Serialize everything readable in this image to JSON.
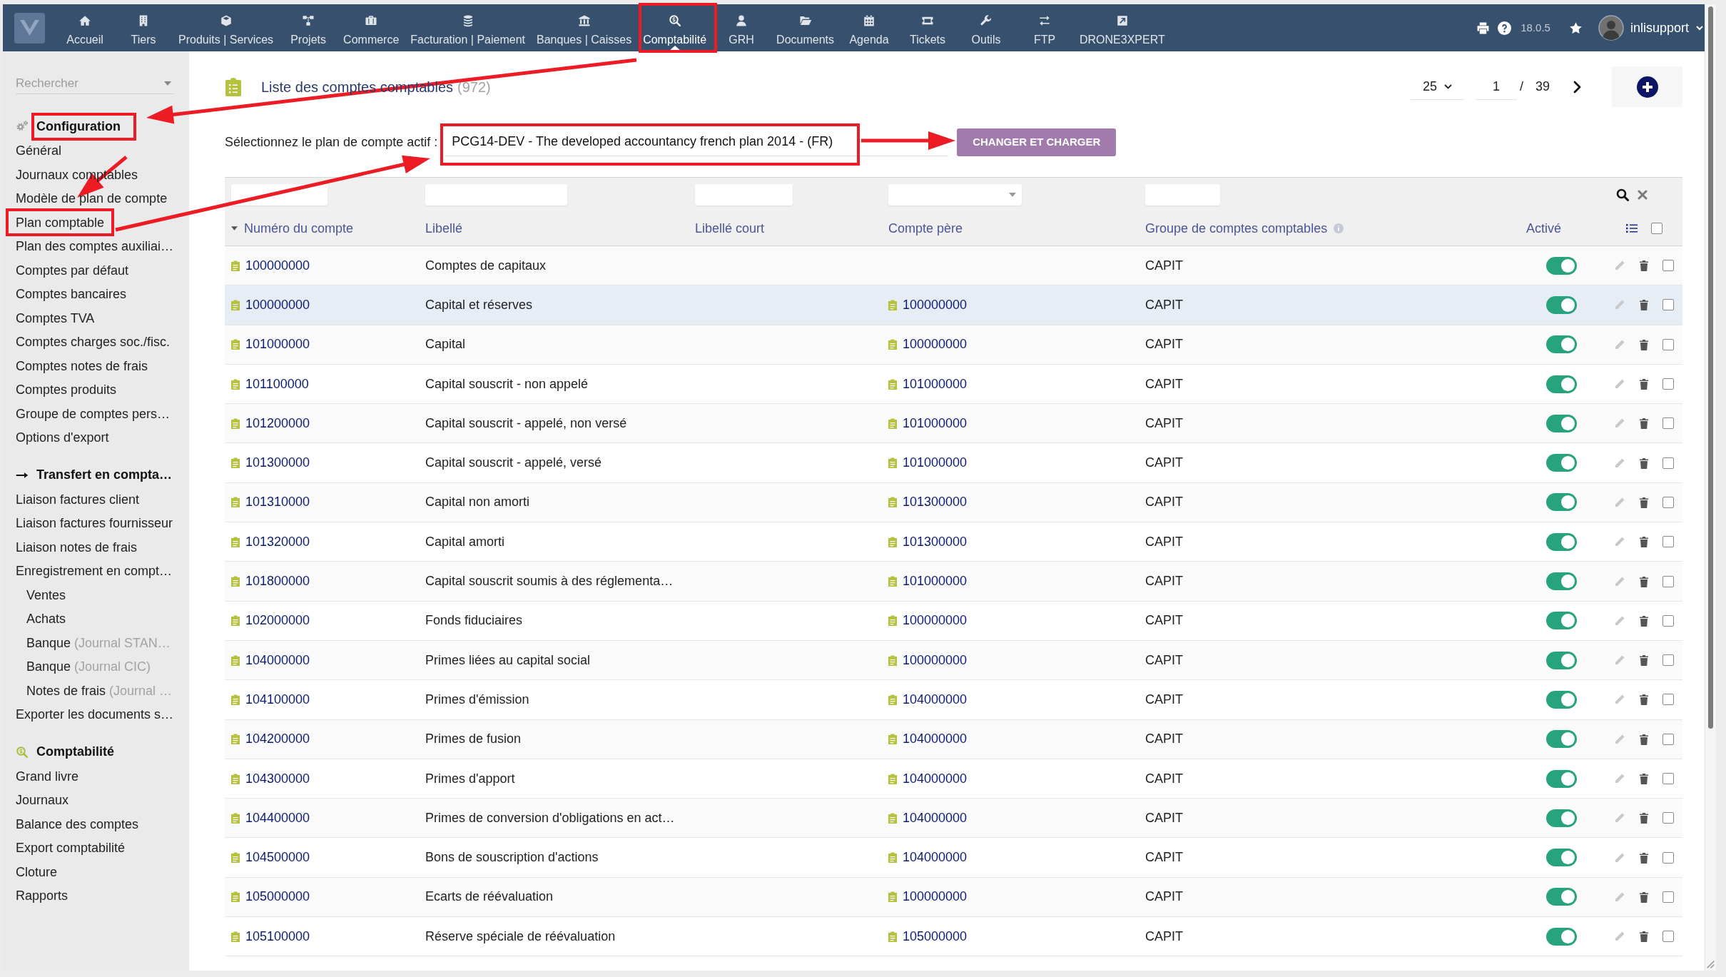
{
  "top_nav": {
    "items": [
      {
        "label": "Accueil",
        "selected": false
      },
      {
        "label": "Tiers",
        "selected": false
      },
      {
        "label": "Produits | Services",
        "selected": false
      },
      {
        "label": "Projets",
        "selected": false
      },
      {
        "label": "Commerce",
        "selected": false
      },
      {
        "label": "Facturation | Paiement",
        "selected": false
      },
      {
        "label": "Banques | Caisses",
        "selected": false
      },
      {
        "label": "Comptabilité",
        "selected": true
      },
      {
        "label": "GRH",
        "selected": false
      },
      {
        "label": "Documents",
        "selected": false
      },
      {
        "label": "Agenda",
        "selected": false
      },
      {
        "label": "Tickets",
        "selected": false
      },
      {
        "label": "Outils",
        "selected": false
      },
      {
        "label": "FTP",
        "selected": false
      },
      {
        "label": "DRONE3XPERT",
        "selected": false
      }
    ],
    "version": "18.0.5",
    "user": "inlisupport"
  },
  "sidebar": {
    "search": {
      "placeholder": "Rechercher"
    },
    "sections": [
      {
        "title": "Configuration",
        "items": [
          {
            "label": "Général"
          },
          {
            "label": "Journaux comptables"
          },
          {
            "label": "Modèle de plan de compte"
          },
          {
            "label": "Plan comptable"
          },
          {
            "label": "Plan des comptes auxiliai…"
          },
          {
            "label": "Comptes par défaut"
          },
          {
            "label": "Comptes bancaires"
          },
          {
            "label": "Comptes TVA"
          },
          {
            "label": "Comptes charges soc./fisc."
          },
          {
            "label": "Comptes notes de frais"
          },
          {
            "label": "Comptes produits"
          },
          {
            "label": "Groupe de comptes pers…"
          },
          {
            "label": "Options d'export"
          }
        ]
      },
      {
        "title": "Transfert en compta…",
        "items": [
          {
            "label": "Liaison factures client"
          },
          {
            "label": "Liaison factures fournisseur"
          },
          {
            "label": "Liaison notes de frais"
          },
          {
            "label": "Enregistrement en compt…",
            "children": [
              {
                "label": "Ventes"
              },
              {
                "label": "Achats"
              },
              {
                "label": "Banque",
                "note": "(Journal STAN…"
              },
              {
                "label": "Banque",
                "note": "(Journal CIC)"
              },
              {
                "label": "Notes de frais",
                "note": "(Journal …"
              }
            ]
          },
          {
            "label": "Exporter les documents s…"
          }
        ]
      },
      {
        "title": "Comptabilité",
        "items": [
          {
            "label": "Grand livre"
          },
          {
            "label": "Journaux"
          },
          {
            "label": "Balance des comptes"
          },
          {
            "label": "Export comptabilité"
          },
          {
            "label": "Cloture"
          },
          {
            "label": "Rapports"
          }
        ]
      }
    ]
  },
  "main": {
    "title": "Liste des comptes comptables",
    "count": "(972)",
    "pagination": {
      "page_size": "25",
      "page": "1",
      "separator": "/",
      "total_pages": "39"
    },
    "chart_select": {
      "label": "Sélectionnez le plan de compte actif :",
      "value": "PCG14-DEV - The developed accountancy french plan 2014 - (FR)"
    },
    "apply_button": "CHANGER ET CHARGER"
  },
  "table": {
    "filters": [
      {
        "kind": "text"
      },
      {
        "kind": "text"
      },
      {
        "kind": "text"
      },
      {
        "kind": "select"
      },
      {
        "kind": "text"
      }
    ],
    "columns": [
      {
        "label": "Numéro du compte",
        "sorted": true,
        "info": false
      },
      {
        "label": "Libellé",
        "sorted": false,
        "info": false
      },
      {
        "label": "Libellé court",
        "sorted": false,
        "info": false
      },
      {
        "label": "Compte père",
        "sorted": false,
        "info": false
      },
      {
        "label": "Groupe de comptes comptables",
        "sorted": false,
        "info": true
      },
      {
        "label": "Activé",
        "sorted": false,
        "info": false
      }
    ],
    "select_all_checked": false,
    "rows": [
      {
        "account": "100000000",
        "label": "Comptes de capitaux",
        "group": "CAPIT",
        "active": true,
        "checked": false,
        "highlighted": false
      },
      {
        "account": "100000000",
        "label": "Capital et réserves",
        "parent": "100000000",
        "group": "CAPIT",
        "active": true,
        "checked": false,
        "highlighted": true
      },
      {
        "account": "101000000",
        "label": "Capital",
        "parent": "100000000",
        "group": "CAPIT",
        "active": true,
        "checked": false,
        "highlighted": false
      },
      {
        "account": "101100000",
        "label": "Capital souscrit - non appelé",
        "parent": "101000000",
        "group": "CAPIT",
        "active": true,
        "checked": false,
        "highlighted": false
      },
      {
        "account": "101200000",
        "label": "Capital souscrit - appelé, non versé",
        "parent": "101000000",
        "group": "CAPIT",
        "active": true,
        "checked": false,
        "highlighted": false
      },
      {
        "account": "101300000",
        "label": "Capital souscrit - appelé, versé",
        "parent": "101000000",
        "group": "CAPIT",
        "active": true,
        "checked": false,
        "highlighted": false
      },
      {
        "account": "101310000",
        "label": "Capital non amorti",
        "parent": "101300000",
        "group": "CAPIT",
        "active": true,
        "checked": false,
        "highlighted": false
      },
      {
        "account": "101320000",
        "label": "Capital amorti",
        "parent": "101300000",
        "group": "CAPIT",
        "active": true,
        "checked": false,
        "highlighted": false
      },
      {
        "account": "101800000",
        "label": "Capital souscrit soumis à des réglementa…",
        "parent": "101000000",
        "group": "CAPIT",
        "active": true,
        "checked": false,
        "highlighted": false
      },
      {
        "account": "102000000",
        "label": "Fonds fiduciaires",
        "parent": "100000000",
        "group": "CAPIT",
        "active": true,
        "checked": false,
        "highlighted": false
      },
      {
        "account": "104000000",
        "label": "Primes liées au capital social",
        "parent": "100000000",
        "group": "CAPIT",
        "active": true,
        "checked": false,
        "highlighted": false
      },
      {
        "account": "104100000",
        "label": "Primes d'émission",
        "parent": "104000000",
        "group": "CAPIT",
        "active": true,
        "checked": false,
        "highlighted": false
      },
      {
        "account": "104200000",
        "label": "Primes de fusion",
        "parent": "104000000",
        "group": "CAPIT",
        "active": true,
        "checked": false,
        "highlighted": false
      },
      {
        "account": "104300000",
        "label": "Primes d'apport",
        "parent": "104000000",
        "group": "CAPIT",
        "active": true,
        "checked": false,
        "highlighted": false
      },
      {
        "account": "104400000",
        "label": "Primes de conversion d'obligations en act…",
        "parent": "104000000",
        "group": "CAPIT",
        "active": true,
        "checked": false,
        "highlighted": false
      },
      {
        "account": "104500000",
        "label": "Bons de souscription d'actions",
        "parent": "104000000",
        "group": "CAPIT",
        "active": true,
        "checked": false,
        "highlighted": false
      },
      {
        "account": "105000000",
        "label": "Ecarts de réévaluation",
        "parent": "100000000",
        "group": "CAPIT",
        "active": true,
        "checked": false,
        "highlighted": false
      },
      {
        "account": "105100000",
        "label": "Réserve spéciale de réévaluation",
        "parent": "105000000",
        "group": "CAPIT",
        "active": true,
        "checked": false,
        "highlighted": false
      }
    ]
  }
}
